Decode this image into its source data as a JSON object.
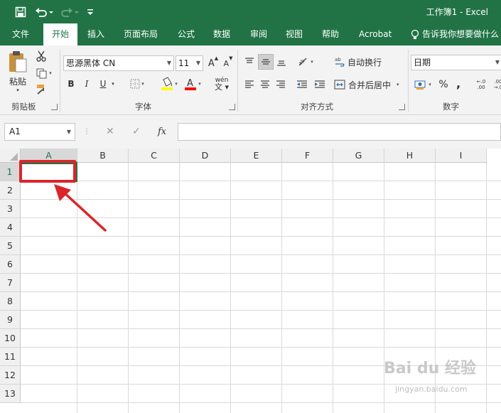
{
  "window": {
    "title": "工作簿1  -  Excel"
  },
  "tabs": [
    "文件",
    "开始",
    "插入",
    "页面布局",
    "公式",
    "数据",
    "审阅",
    "视图",
    "帮助",
    "Acrobat"
  ],
  "active_tab": "开始",
  "tell_me": "告诉我你想要做什么",
  "ribbon": {
    "clipboard": {
      "paste_label": "粘贴",
      "group_label": "剪贴板"
    },
    "font": {
      "font_name": "思源黑体 CN",
      "font_size": "11",
      "bold": "B",
      "italic": "I",
      "underline": "U",
      "phonetic": "wén",
      "group_label": "字体",
      "fill_color": "#ffff00",
      "font_color": "#ff0000"
    },
    "alignment": {
      "wrap_text": "自动换行",
      "merge_center": "合并后居中",
      "group_label": "对齐方式"
    },
    "number": {
      "format": "日期",
      "percent": "%",
      "comma": ",",
      "group_label": "数字"
    }
  },
  "formula_bar": {
    "name_box": "A1",
    "fx": "fx",
    "cancel": "✕",
    "enter": "✓",
    "value": ""
  },
  "grid": {
    "columns": [
      "A",
      "B",
      "C",
      "D",
      "E",
      "F",
      "G",
      "H",
      "I"
    ],
    "rows": [
      "1",
      "2",
      "3",
      "4",
      "5",
      "6",
      "7",
      "8",
      "9",
      "10",
      "11",
      "12",
      "13"
    ],
    "selected_cell": "A1"
  },
  "annotation": {
    "color": "#d9262b"
  },
  "watermark": {
    "text": "Bai du 经验",
    "sub": "jingyan.baidu.com"
  }
}
